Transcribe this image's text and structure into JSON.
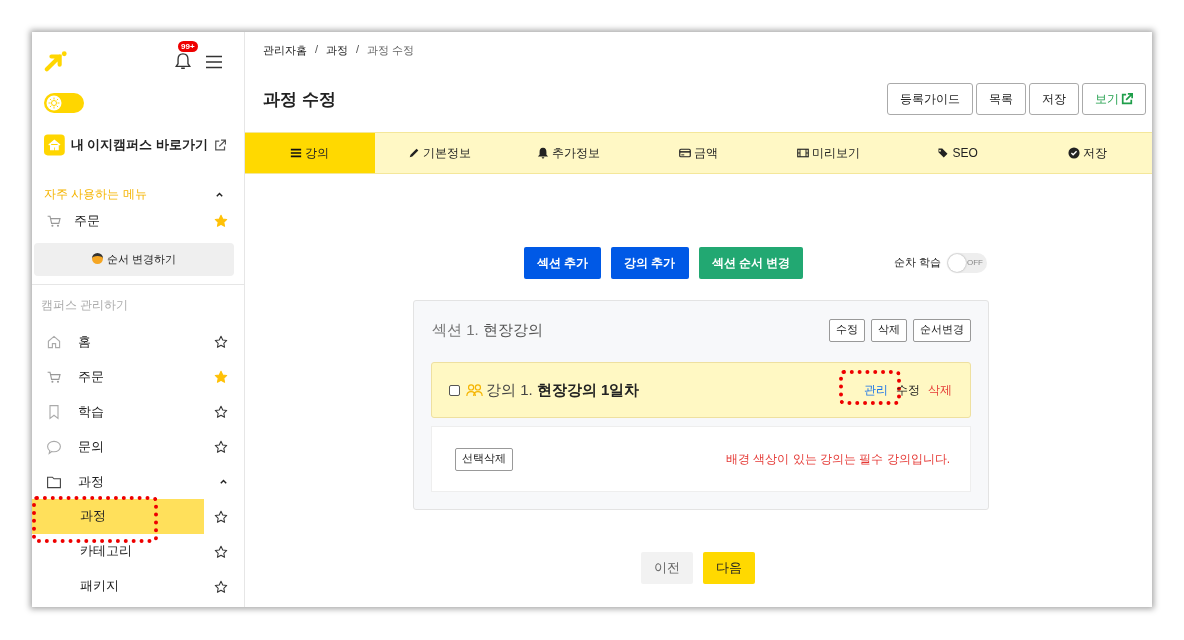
{
  "sidebar": {
    "notification_badge": "99+",
    "theme_toggle": {
      "on": true
    },
    "campus_link": "내 이지캠퍼스 바로가기",
    "favorites": {
      "title": "자주 사용하는 메뉴",
      "expanded": true,
      "items": [
        {
          "label": "주문",
          "starred": true
        }
      ]
    },
    "reorder_button": "순서 변경하기",
    "manage": {
      "title": "캠퍼스 관리하기",
      "items": [
        {
          "label": "홈",
          "starred": false
        },
        {
          "label": "주문",
          "starred": true
        },
        {
          "label": "학습",
          "starred": false
        },
        {
          "label": "문의",
          "starred": false
        },
        {
          "label": "과정",
          "expanded": true,
          "children": [
            {
              "label": "과정",
              "selected": true,
              "starred": false,
              "highlighted": true
            },
            {
              "label": "카테고리",
              "selected": false,
              "starred": false,
              "highlighted": false
            },
            {
              "label": "패키지",
              "selected": false,
              "starred": false,
              "highlighted": false
            }
          ]
        }
      ]
    }
  },
  "breadcrumb": [
    {
      "kind": "link",
      "text": "관리자홈"
    },
    {
      "kind": "separator",
      "text": "/"
    },
    {
      "kind": "link",
      "text": "과정"
    },
    {
      "kind": "separator",
      "text": "/"
    },
    {
      "kind": "current",
      "text": "과정 수정"
    }
  ],
  "page_title": "과정 수정",
  "header_buttons": [
    {
      "label": "등록가이드",
      "kind": "plain"
    },
    {
      "label": "목록",
      "kind": "plain"
    },
    {
      "label": "저장",
      "kind": "plain"
    },
    {
      "label": "보기",
      "kind": "external"
    }
  ],
  "tabs": [
    {
      "label": "강의",
      "selected": true
    },
    {
      "label": "기본정보",
      "selected": false
    },
    {
      "label": "추가정보",
      "selected": false
    },
    {
      "label": "금액",
      "selected": false
    },
    {
      "label": "미리보기",
      "selected": false
    },
    {
      "label": "SEO",
      "selected": false
    },
    {
      "label": "저장",
      "selected": false
    }
  ],
  "action_buttons": [
    {
      "label": "섹션 추가",
      "color": "#0059e6"
    },
    {
      "label": "강의 추가",
      "color": "#0059e6"
    },
    {
      "label": "섹션 순서 변경",
      "color": "#22a872"
    }
  ],
  "sequential_learning": {
    "label": "순차 학습",
    "on": false,
    "state_label": "OFF"
  },
  "section": {
    "number": "섹션 1.",
    "title": "현장강의",
    "buttons": [
      "수정",
      "삭제",
      "순서변경"
    ],
    "lecture": {
      "checked": false,
      "required": true,
      "number": "강의 1.",
      "title": "현장강의 1일차",
      "actions": [
        {
          "label": "관리",
          "kind": "manage",
          "highlighted": true
        },
        {
          "label": "수정",
          "kind": "edit",
          "highlighted": false
        },
        {
          "label": "삭제",
          "kind": "delete",
          "highlighted": false
        }
      ]
    },
    "bulk_delete": "선택삭제",
    "notice": "배경 색상이 있는 강의는 필수 강의입니다."
  },
  "pager": [
    {
      "label": "이전",
      "kind": "secondary"
    },
    {
      "label": "다음",
      "kind": "primary"
    }
  ]
}
